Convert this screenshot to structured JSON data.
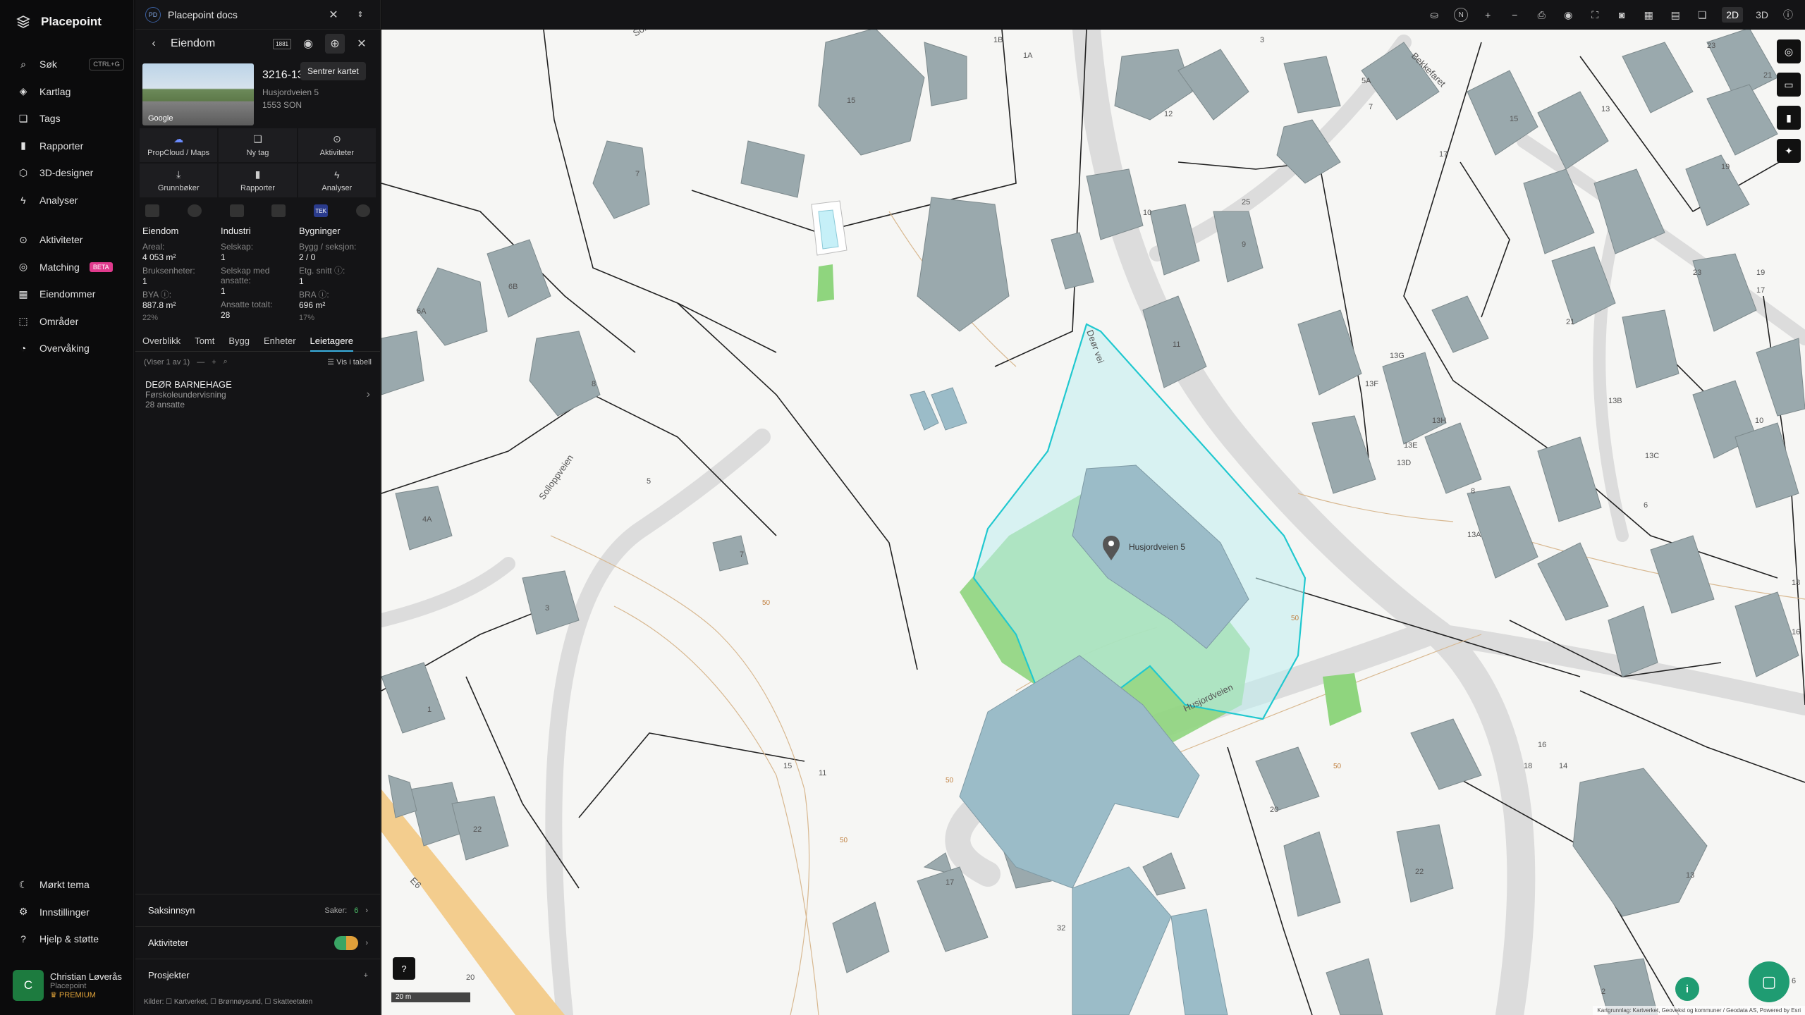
{
  "brand": "Placepoint",
  "nav": {
    "items": [
      {
        "label": "Søk",
        "icon": "search-icon",
        "kbd": "CTRL+G"
      },
      {
        "label": "Kartlag",
        "icon": "layers-icon"
      },
      {
        "label": "Tags",
        "icon": "bookmark-icon"
      },
      {
        "label": "Rapporter",
        "icon": "chart-icon"
      },
      {
        "label": "3D-designer",
        "icon": "cube-icon"
      },
      {
        "label": "Analyser",
        "icon": "bolt-icon"
      },
      {
        "label": "Aktiviteter",
        "icon": "activity-icon"
      },
      {
        "label": "Matching",
        "icon": "target-icon",
        "badge": "BETA"
      },
      {
        "label": "Eiendommer",
        "icon": "building-icon"
      },
      {
        "label": "Områder",
        "icon": "area-icon"
      },
      {
        "label": "Overvåking",
        "icon": "monitor-icon"
      }
    ],
    "bottom": [
      {
        "label": "Mørkt tema",
        "icon": "moon-icon"
      },
      {
        "label": "Innstillinger",
        "icon": "gear-icon"
      },
      {
        "label": "Hjelp & støtte",
        "icon": "help-icon"
      }
    ]
  },
  "user": {
    "initial": "C",
    "name": "Christian Løverås",
    "org": "Placepoint",
    "plan": "PREMIUM"
  },
  "panel": {
    "workspace": "Placepoint docs",
    "workspace_badge": "PD",
    "title": "Eiendom",
    "toolbar_badge": "1881",
    "tooltip": "Sentrer kartet",
    "property": {
      "id": "3216-13",
      "address": "Husjordveien 5",
      "postal": "1553 SON",
      "thumb_label": "Google"
    },
    "actions": [
      {
        "label": "PropCloud / Maps",
        "icon": "cloud-icon"
      },
      {
        "label": "Ny tag",
        "icon": "bookmark-icon"
      },
      {
        "label": "Aktiviteter",
        "icon": "activity-icon"
      },
      {
        "label": "Grunnbøker",
        "icon": "download-icon"
      },
      {
        "label": "Rapporter",
        "icon": "chart-icon"
      },
      {
        "label": "Analyser",
        "icon": "bolt-icon"
      }
    ],
    "sources_tek": "TEK",
    "stats": {
      "eiendom": {
        "header": "Eiendom",
        "areal_label": "Areal:",
        "areal": "4 053 m²",
        "bruks_label": "Bruksenheter:",
        "bruks": "1",
        "bya_label": "BYA ⓘ:",
        "bya": "887.8 m²",
        "bya_pct": "22%"
      },
      "industri": {
        "header": "Industri",
        "selskap_label": "Selskap:",
        "selskap": "1",
        "ansatte_label": "Selskap med ansatte:",
        "ansatte": "1",
        "totalt_label": "Ansatte totalt:",
        "totalt": "28"
      },
      "bygninger": {
        "header": "Bygninger",
        "seksjon_label": "Bygg / seksjon:",
        "seksjon": "2 / 0",
        "etg_label": "Etg. snitt ⓘ:",
        "etg": "1",
        "bra_label": "BRA ⓘ:",
        "bra": "696 m²",
        "bra_pct": "17%"
      }
    },
    "tabs": [
      "Overblikk",
      "Tomt",
      "Bygg",
      "Enheter",
      "Leietagere"
    ],
    "active_tab": "Leietagere",
    "list_count": "(Viser 1 av 1)",
    "list_view": "Vis i tabell",
    "tenant": {
      "name": "DEØR BARNEHAGE",
      "category": "Førskoleundervisning",
      "employees": "28 ansatte"
    },
    "sections": [
      {
        "label": "Saksinnsyn",
        "right": "Saker:",
        "count": "6"
      },
      {
        "label": "Aktiviteter"
      },
      {
        "label": "Prosjekter"
      }
    ],
    "sources_line": "Kilder: ☐ Kartverket, ☐ Brønnøysund, ☐ Skatteetaten"
  },
  "map": {
    "view_2d": "2D",
    "view_3d": "3D",
    "compass": "N",
    "scale": "20 m",
    "attribution": "Kartgrunnlag: Kartverket, Geovekst og kommuner / Geodata AS, Powered by Esri",
    "marker_label": "Husjordveien 5",
    "streets": [
      {
        "name": "Solbakveien"
      },
      {
        "name": "Deør vei"
      },
      {
        "name": "Husjordveien"
      },
      {
        "name": "Bekkefaret"
      },
      {
        "name": "Solloppveien"
      },
      {
        "name": "E6"
      }
    ],
    "buildings": [
      "1B",
      "1A",
      "15",
      "3",
      "5A",
      "7",
      "12",
      "17",
      "15",
      "13",
      "23",
      "21",
      "19",
      "7",
      "25",
      "10",
      "9",
      "19",
      "17",
      "23",
      "21",
      "6A",
      "6B",
      "8",
      "11",
      "13G",
      "13F",
      "10",
      "13H",
      "13E",
      "8",
      "13A",
      "13B",
      "13C",
      "13D",
      "6",
      "18",
      "16",
      "5",
      "7",
      "4A",
      "3",
      "1",
      "20",
      "22",
      "13",
      "11",
      "15",
      "17",
      "32",
      "6",
      "22",
      "20",
      "16",
      "18",
      "14",
      "2"
    ],
    "contours": [
      "50",
      "50",
      "50",
      "50",
      "50"
    ]
  }
}
